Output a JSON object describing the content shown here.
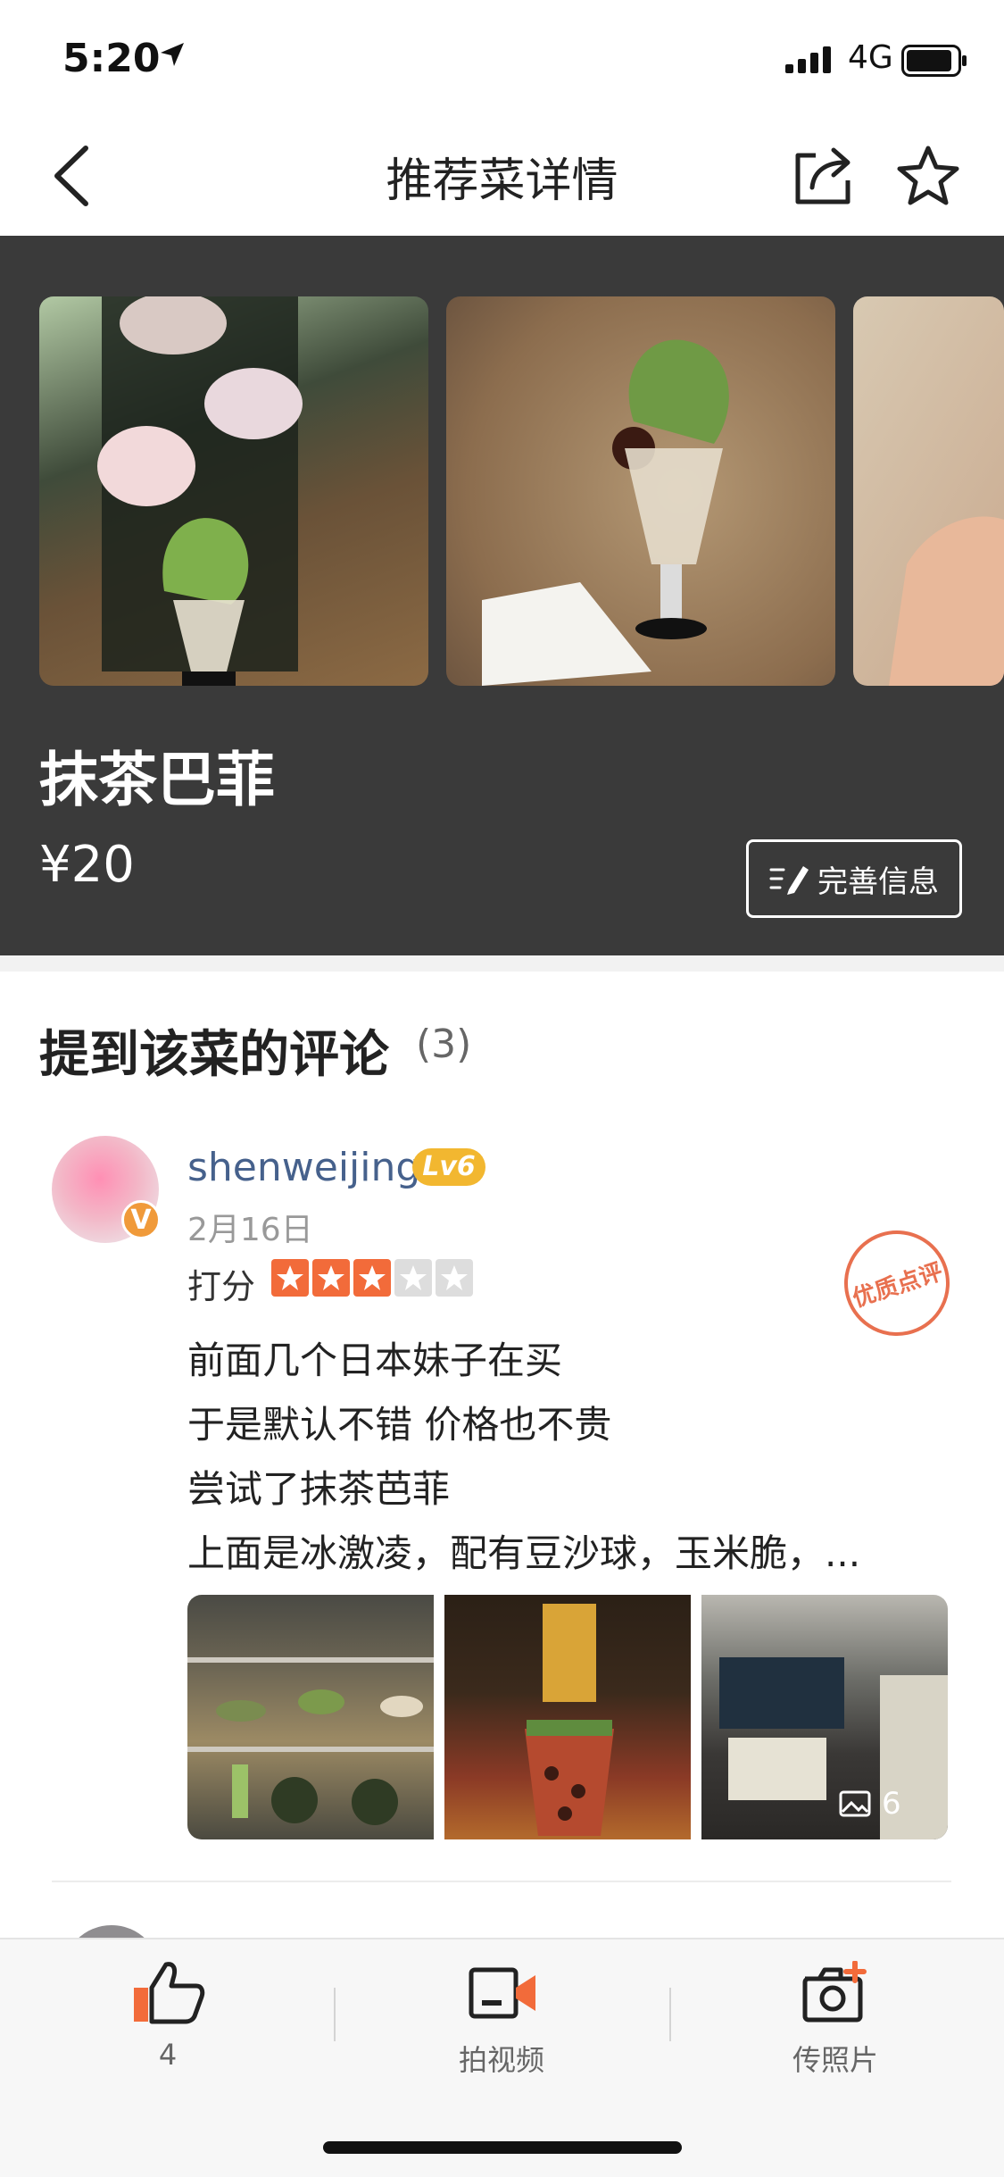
{
  "status_bar": {
    "time": "5:20",
    "network": "4G"
  },
  "nav": {
    "title": "推荐菜详情"
  },
  "dish": {
    "name": "抹茶巴菲",
    "price": "¥20",
    "edit_label": "完善信息"
  },
  "reviews": {
    "title": "提到该菜的评论",
    "count": "(3)",
    "items": [
      {
        "user": "shenweijing",
        "level": "Lv6",
        "date": "2月16日",
        "score_label": "打分",
        "rating": 3,
        "rating_max": 5,
        "stamp": "优质点评",
        "lines": [
          "前面几个日本妹子在买",
          "于是默认不错 价格也不贵",
          "尝试了抹茶芭菲",
          "上面是冰激凌，配有豆沙球，玉米脆，..."
        ],
        "photo_count": "6"
      }
    ]
  },
  "bottom_bar": {
    "like_count": "4",
    "video_label": "拍视频",
    "photo_label": "传照片"
  },
  "colors": {
    "hero_bg": "#3a3a3a",
    "star_on": "#f26b3a",
    "star_off": "#dddddd",
    "username": "#46618c",
    "level_badge": "#f2b730"
  }
}
